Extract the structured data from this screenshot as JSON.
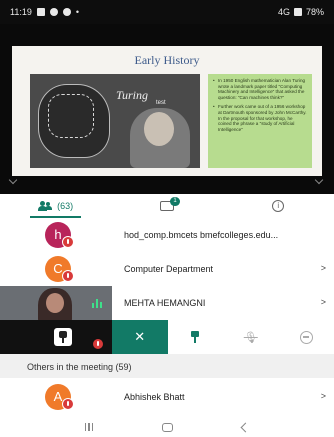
{
  "status_bar": {
    "time": "11:19",
    "notification_icons": [
      "gallery-icon",
      "message-icon",
      "settings-icon"
    ],
    "dot": "•",
    "network": "4G",
    "signal": "signal-icon",
    "battery": "78%"
  },
  "shared_screen": {
    "slide_title": "Early History",
    "image_word": "Turing",
    "image_subword": "test",
    "bullets": [
      "In 1950 English mathematician Alan Turing wrote a landmark paper titled \"Computing Machinery and Intelligence\" that asked the question: \"Can machines think?\"",
      "Further work came out of a 1956 workshop at Dartmouth sponsored by John McCarthy. In the proposal for that workshop, he coined the phrase a \"study of Artificial Intelligence\""
    ]
  },
  "tabs": {
    "participants_count": "(63)",
    "chat_badge": "1"
  },
  "participants": [
    {
      "initial": "h",
      "name": "hod_comp.bmcets bmefcolleges.edu...",
      "avatar_color": "#b8245a",
      "chevron": ""
    },
    {
      "initial": "C",
      "name": "Computer Department",
      "avatar_color": "#f07a2a",
      "chevron": ">"
    },
    {
      "name": "MEHTA HEMANGNI",
      "chevron": ">"
    }
  ],
  "action_bar": {
    "remove_glyph": "✕"
  },
  "others_section": {
    "label": "Others in the meeting (59)"
  },
  "others": [
    {
      "initial": "A",
      "name": "Abhishek Bhatt",
      "avatar_color": "#f07a2a",
      "chevron": ">"
    }
  ],
  "colors": {
    "accent": "#127a66",
    "mute_red": "#d83a3a"
  }
}
